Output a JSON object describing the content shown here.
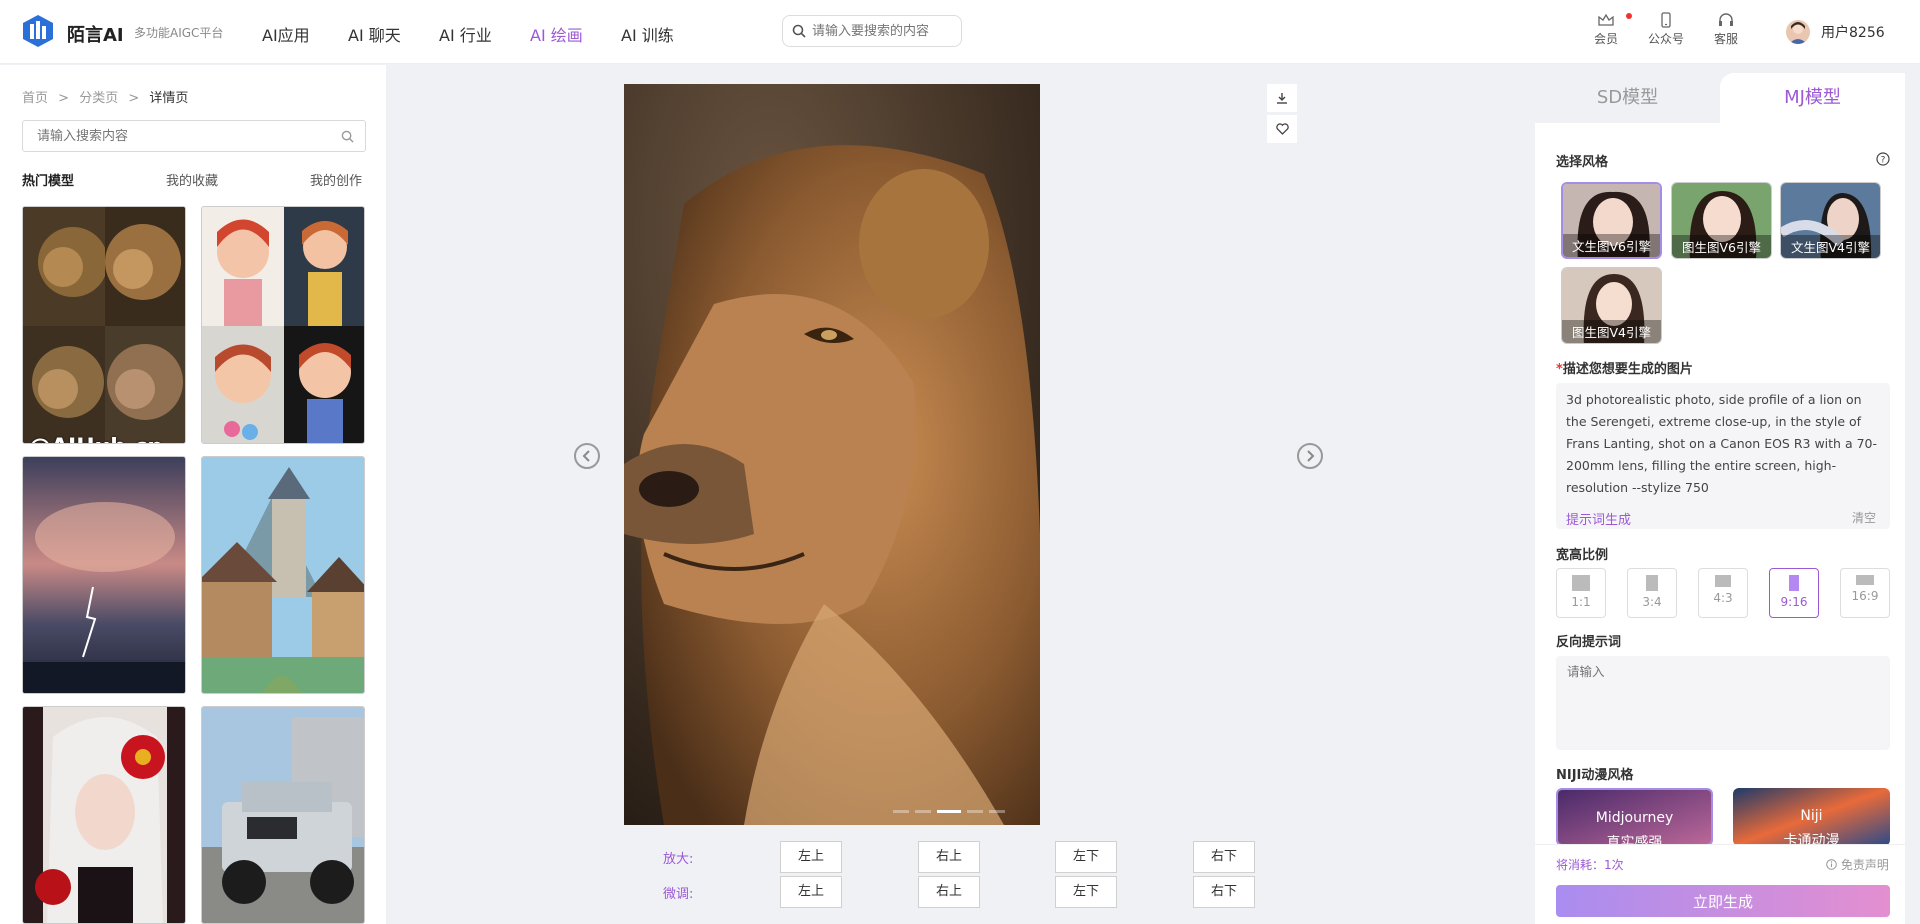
{
  "header": {
    "brand": "陌言AI",
    "subtitle": "多功能AIGC平台",
    "nav": [
      "AI应用",
      "AI 聊天",
      "AI 行业",
      "AI 绘画",
      "AI 训练"
    ],
    "active_nav": "AI 绘画",
    "search_placeholder": "请输入要搜索的内容",
    "icons": [
      {
        "label": "会员",
        "icon": "crown-icon"
      },
      {
        "label": "公众号",
        "icon": "phone-icon"
      },
      {
        "label": "客服",
        "icon": "headset-icon"
      }
    ],
    "username": "用户8256"
  },
  "left": {
    "breadcrumb": [
      "首页",
      "分类页",
      "详情页"
    ],
    "search_placeholder": "请输入搜索内容",
    "tabs": [
      "热门模型",
      "我的收藏",
      "我的创作"
    ],
    "watermark": "@AIHub.cn",
    "thumbnails": [
      "lion-collage",
      "cartoon-girl-collage",
      "stormy-sea",
      "castle-village",
      "white-hair-girl",
      "jeep"
    ]
  },
  "viewer": {
    "tools": [
      "download-icon",
      "heart-icon"
    ],
    "zoom_label": "放大:",
    "fine_label": "微调:",
    "buttons": [
      "左上",
      "右上",
      "左下",
      "右下"
    ]
  },
  "right": {
    "tabs": [
      "SD模型",
      "MJ模型"
    ],
    "style_title": "选择风格",
    "styles": [
      "文生图V6引擎",
      "图生图V6引擎",
      "文生图V4引擎",
      "图生图V4引擎"
    ],
    "prompt_title": "描述您想要生成的图片",
    "prompt_text": "3d photorealistic photo, side profile of a lion on the Serengeti, extreme close-up, in the style of Frans Lanting, shot on a Canon EOS R3 with a 70-200mm lens, filling the entire screen, high-resolution  --stylize 750",
    "prompt_gen": "提示词生成",
    "prompt_clear": "清空",
    "ratio_title": "宽高比例",
    "ratios": [
      "1:1",
      "3:4",
      "4:3",
      "9:16",
      "16:9"
    ],
    "selected_ratio": "9:16",
    "neg_title": "反向提示词",
    "neg_placeholder": "请输入",
    "niji_title": "NIJI动漫风格",
    "niji": [
      {
        "l1": "Midjourney",
        "l2": "真实感强"
      },
      {
        "l1": "Niji",
        "l2": "卡通动漫"
      }
    ],
    "cost": "将消耗：1次",
    "disclaimer": "免责声明",
    "generate": "立即生成"
  },
  "colors": {
    "accent": "#9b59d6",
    "button_start": "#a98df0",
    "button_end": "#e48fd0"
  }
}
